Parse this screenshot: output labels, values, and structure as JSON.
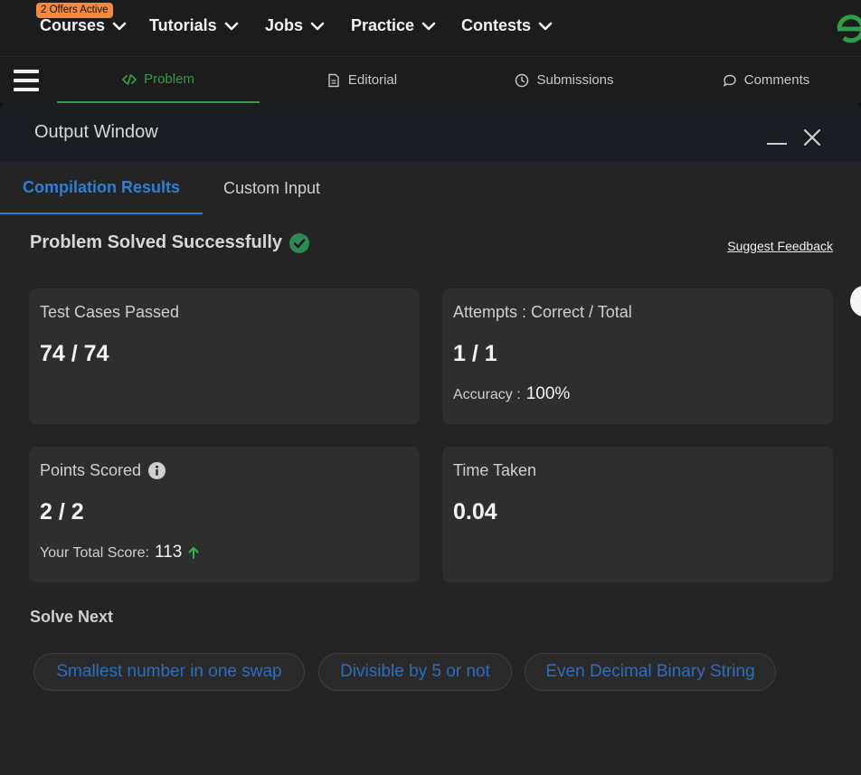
{
  "topnav": {
    "offer_badge": "2 Offers Active",
    "items": [
      "Courses",
      "Tutorials",
      "Jobs",
      "Practice",
      "Contests"
    ]
  },
  "problem_tabs": {
    "problem": "Problem",
    "editorial": "Editorial",
    "submissions": "Submissions",
    "comments": "Comments"
  },
  "output": {
    "title": "Output Window",
    "tabs": {
      "compilation": "Compilation Results",
      "custom": "Custom Input"
    },
    "status": "Problem Solved Successfully",
    "feedback": "Suggest Feedback",
    "cards": {
      "tests": {
        "label": "Test Cases Passed",
        "value": "74 / 74"
      },
      "attempts": {
        "label": "Attempts : Correct / Total",
        "value": "1 / 1",
        "sub_label": "Accuracy :",
        "sub_value": "100%"
      },
      "points": {
        "label": "Points Scored",
        "value": "2 / 2",
        "sub_label": "Your Total Score:",
        "sub_value": "113"
      },
      "time": {
        "label": "Time Taken",
        "value": "0.04"
      }
    },
    "solve_next": {
      "heading": "Solve Next",
      "items": [
        "Smallest number in one swap",
        "Divisible by 5 or not",
        "Even Decimal Binary String"
      ]
    }
  },
  "colors": {
    "accent_green": "#2f9e44",
    "accent_blue": "#2f7fd3",
    "offer": "#f6893b"
  }
}
